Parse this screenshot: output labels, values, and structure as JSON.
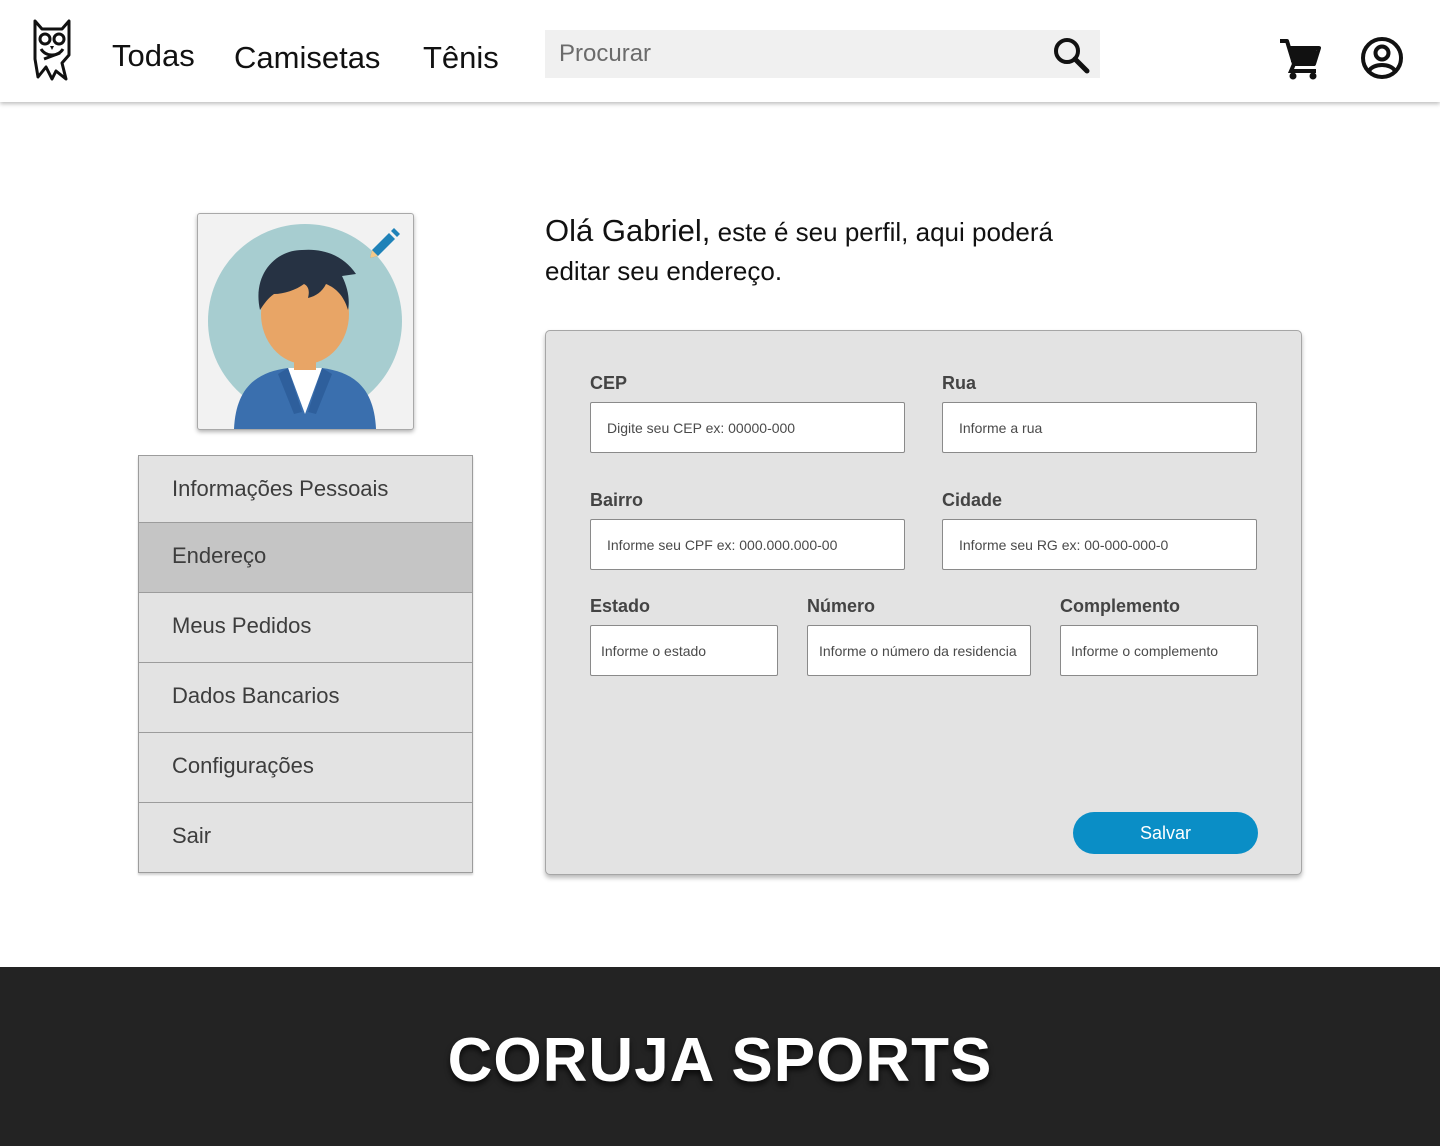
{
  "header": {
    "nav": {
      "todas": "Todas",
      "camisetas": "Camisetas",
      "tenis": "Tênis"
    },
    "search_placeholder": "Procurar"
  },
  "avatar": {},
  "side_menu": {
    "items": [
      {
        "label": "Informações Pessoais"
      },
      {
        "label": "Endereço",
        "active": true
      },
      {
        "label": "Meus Pedidos"
      },
      {
        "label": "Dados Bancarios"
      },
      {
        "label": "Configurações"
      },
      {
        "label": "Sair"
      }
    ]
  },
  "greeting": {
    "name": "Olá Gabriel,",
    "text": " este é seu perfil, aqui poderá editar seu endereço."
  },
  "form": {
    "cep": {
      "label": "CEP",
      "placeholder": "Digite seu CEP ex: 00000-000"
    },
    "rua": {
      "label": "Rua",
      "placeholder": "Informe a rua"
    },
    "bairro": {
      "label": "Bairro",
      "placeholder": "Informe seu CPF ex: 000.000.000-00"
    },
    "cidade": {
      "label": "Cidade",
      "placeholder": "Informe seu RG ex: 00-000-000-0"
    },
    "estado": {
      "label": "Estado",
      "placeholder": "Informe o estado"
    },
    "numero": {
      "label": "Número",
      "placeholder": "Informe o número da residencia"
    },
    "complemento": {
      "label": "Complemento",
      "placeholder": "Informe o complemento"
    },
    "save_label": "Salvar"
  },
  "footer": {
    "brand": "CORUJA SPORTS"
  },
  "colors": {
    "accent": "#0a8ec6",
    "footer_bg": "#232323",
    "panel_bg": "#e3e3e3",
    "menu_active": "#c5c5c5"
  },
  "icons": [
    "owl-logo-icon",
    "search-icon",
    "cart-icon",
    "account-icon",
    "pencil-edit-icon"
  ]
}
